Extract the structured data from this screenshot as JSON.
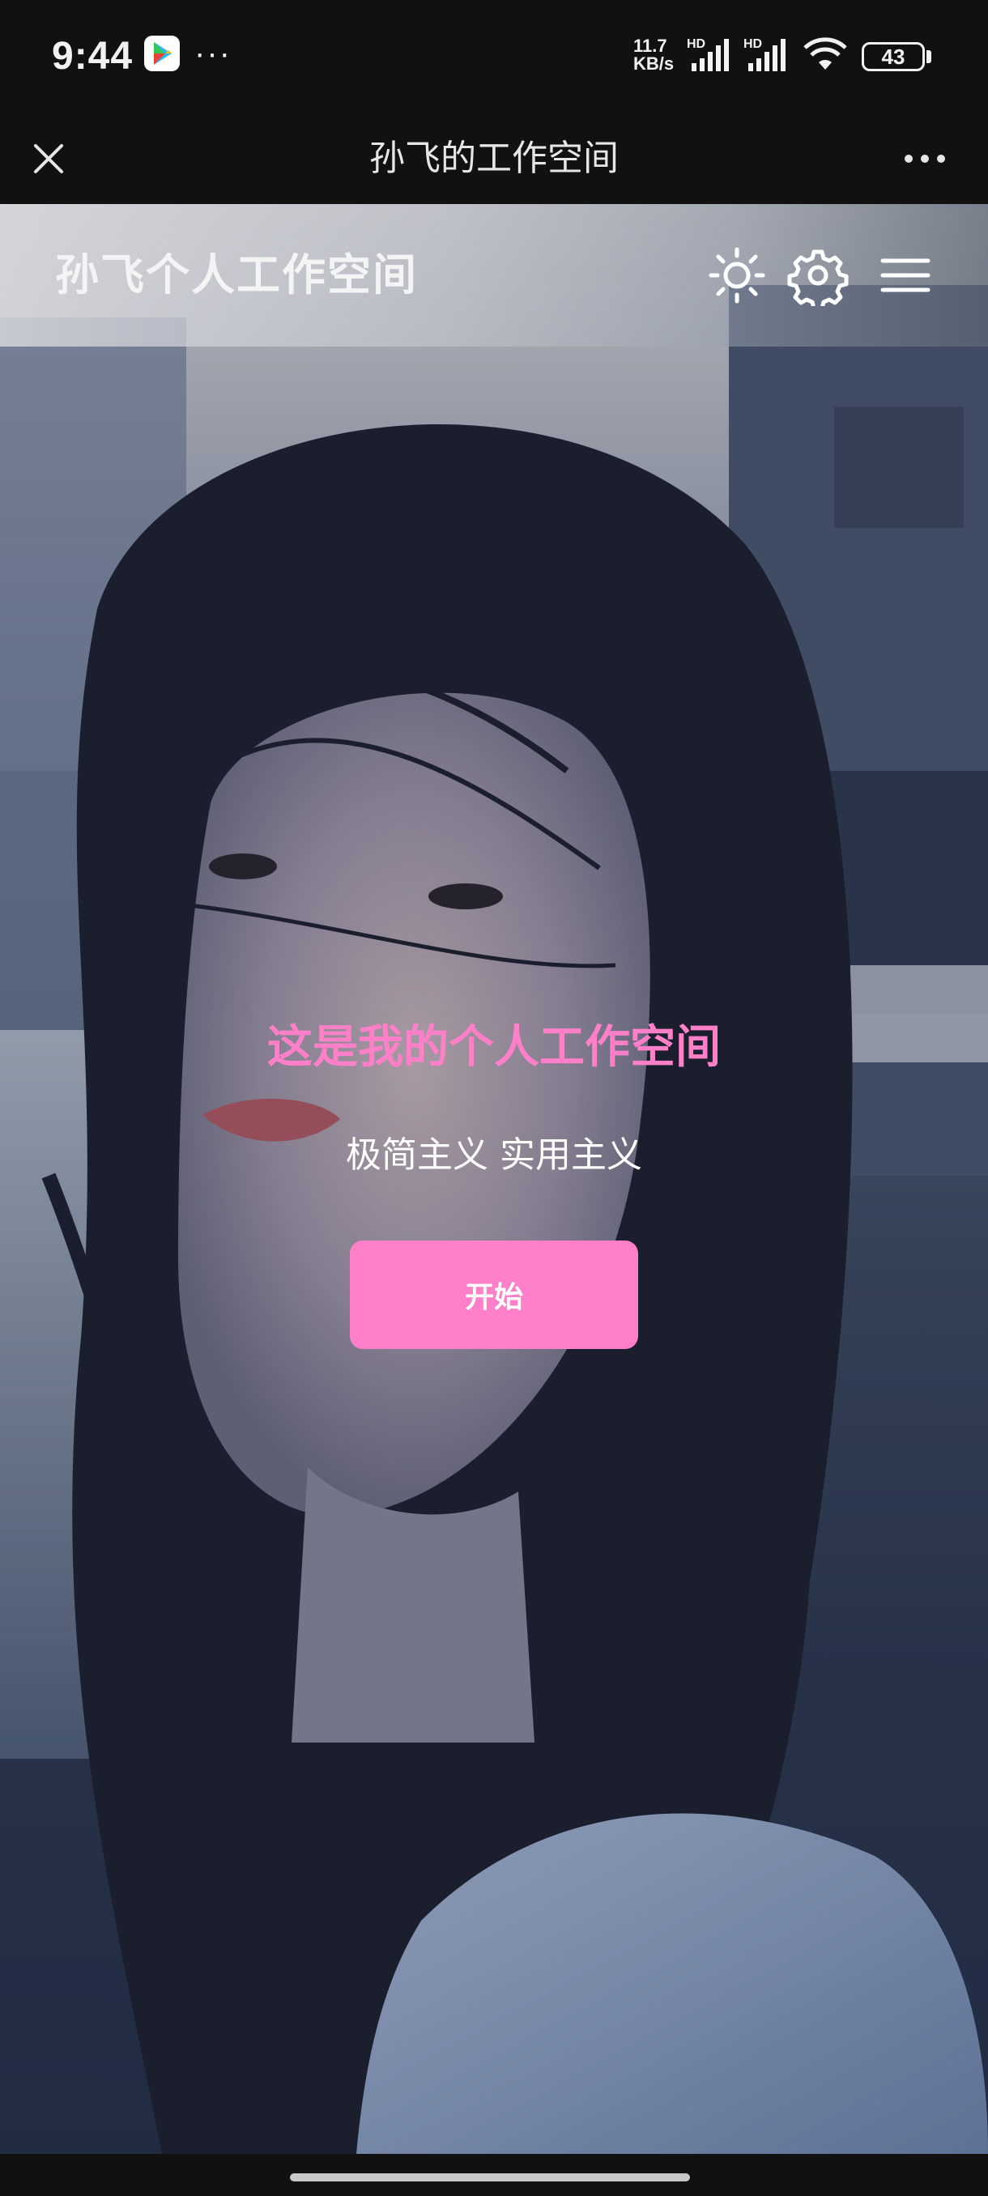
{
  "status_bar": {
    "time": "9:44",
    "more": "···",
    "net_speed_value": "11.7",
    "net_speed_unit": "KB/s",
    "hd1": "HD",
    "hd2": "HD",
    "battery": "43",
    "icons": [
      "play-store-icon",
      "signal-icon",
      "wifi-icon",
      "battery-icon"
    ]
  },
  "title_bar": {
    "title": "孙飞的工作空间",
    "icons": [
      "close-icon",
      "more-icon"
    ]
  },
  "site_header": {
    "title": "孙飞个人工作空间",
    "icons": [
      "sun-icon",
      "gear-icon",
      "menu-icon"
    ]
  },
  "hero": {
    "heading": "这是我的个人工作空间",
    "subtitle": "极简主义 实用主义",
    "button_label": "开始",
    "background": "photo of a woman with long windblown dark hair by a waterfront",
    "colors": {
      "accent": "#ff80c8",
      "heading": "#ff7fc8"
    }
  }
}
